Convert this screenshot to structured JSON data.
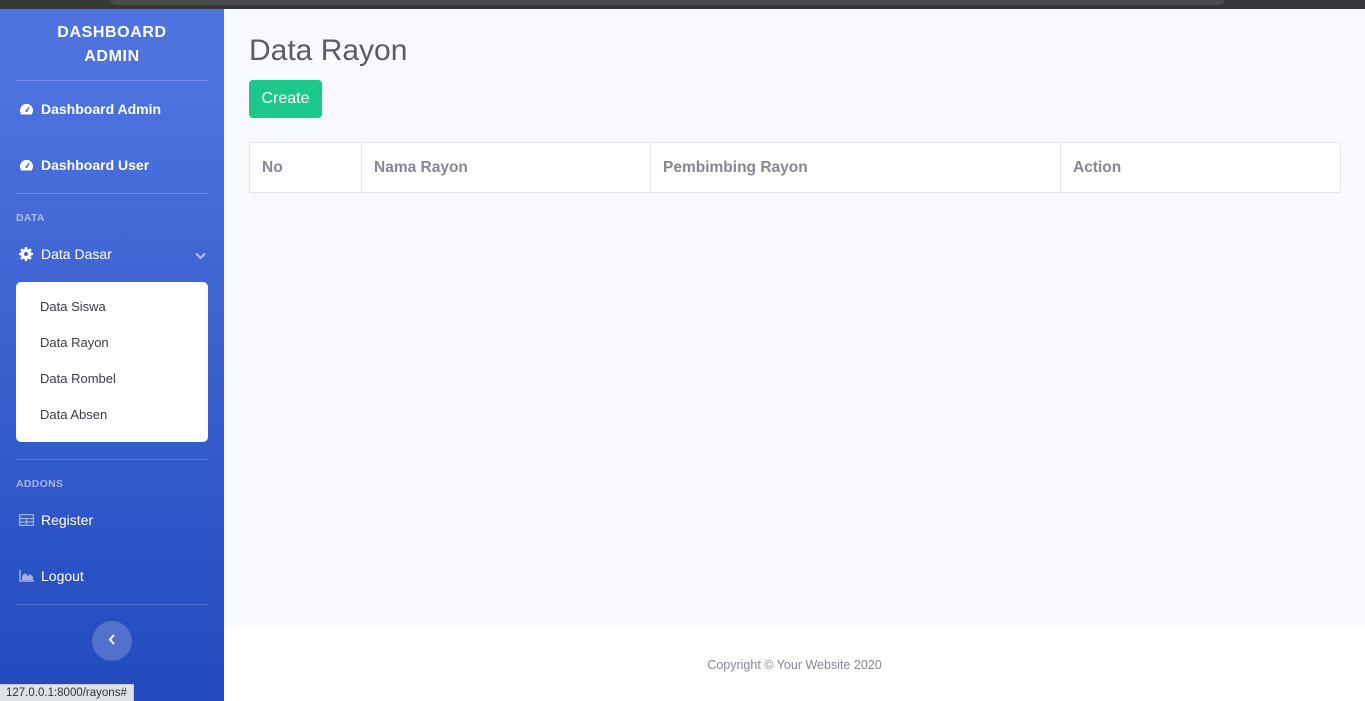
{
  "sidebar": {
    "brand_line1": "DASHBOARD",
    "brand_line2": "ADMIN",
    "items": {
      "dashboard_admin": "Dashboard Admin",
      "dashboard_user": "Dashboard User",
      "data_dasar": "Data Dasar",
      "register": "Register",
      "logout": "Logout"
    },
    "heading_data": "DATA",
    "heading_addons": "ADDONS",
    "submenu": [
      "Data Siswa",
      "Data Rayon",
      "Data Rombel",
      "Data Absen"
    ]
  },
  "main": {
    "title": "Data Rayon",
    "create_label": "Create",
    "table": {
      "columns": [
        "No",
        "Nama Rayon",
        "Pembimbing Rayon",
        "Action"
      ],
      "rows": []
    }
  },
  "footer": {
    "copyright": "Copyright © Your Website 2020"
  },
  "status_url": "127.0.0.1:8000/rayons#",
  "colors": {
    "sidebar_top": "#4e73df",
    "sidebar_bottom": "#224abe",
    "success": "#1cc88a",
    "text_gray": "#858796"
  }
}
